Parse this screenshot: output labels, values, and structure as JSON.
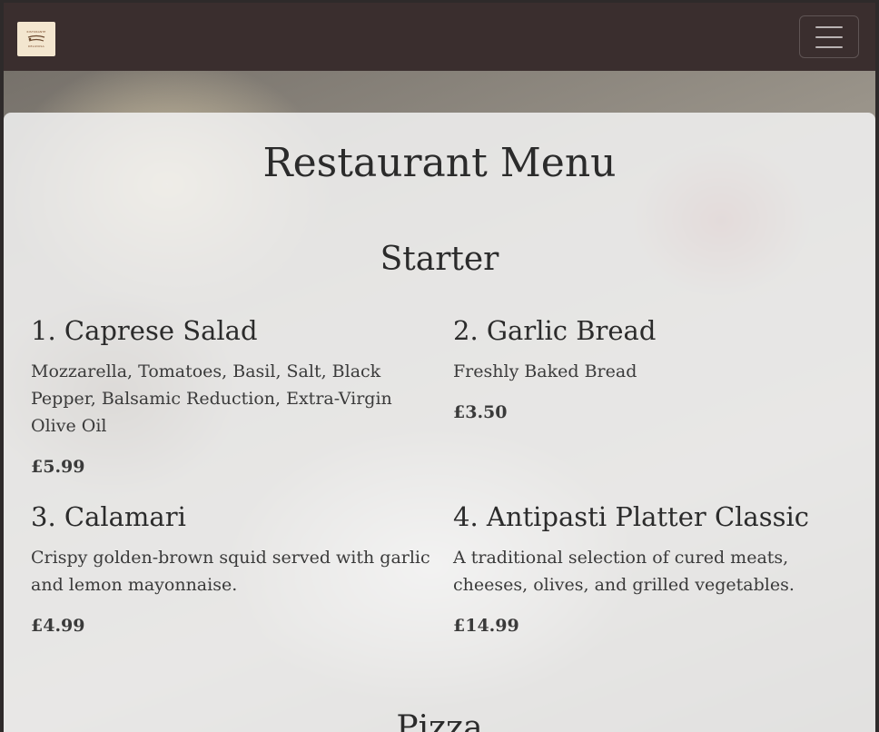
{
  "navbar": {
    "logo": {
      "icon": "restaurant-logo-icon",
      "line1": "RISTORANTE",
      "line2": "DELIZIOSA"
    },
    "toggler_icon": "hamburger-menu-icon"
  },
  "page": {
    "title": "Restaurant Menu"
  },
  "sections": [
    {
      "title": "Starter",
      "items": [
        {
          "name": "1. Caprese Salad",
          "description": "Mozzarella, Tomatoes, Basil, Salt, Black Pepper, Balsamic Reduction, Extra-Virgin Olive Oil",
          "price": "£5.99"
        },
        {
          "name": "2. Garlic Bread",
          "description": "Freshly Baked Bread",
          "price": "£3.50"
        },
        {
          "name": "3. Calamari",
          "description": "Crispy golden-brown squid served with garlic and lemon mayonnaise.",
          "price": "£4.99"
        },
        {
          "name": "4. Antipasti Platter Classic",
          "description": "A traditional selection of cured meats, cheeses, olives, and grilled vegetables.",
          "price": "£14.99"
        }
      ]
    },
    {
      "title": "Pizza"
    }
  ]
}
